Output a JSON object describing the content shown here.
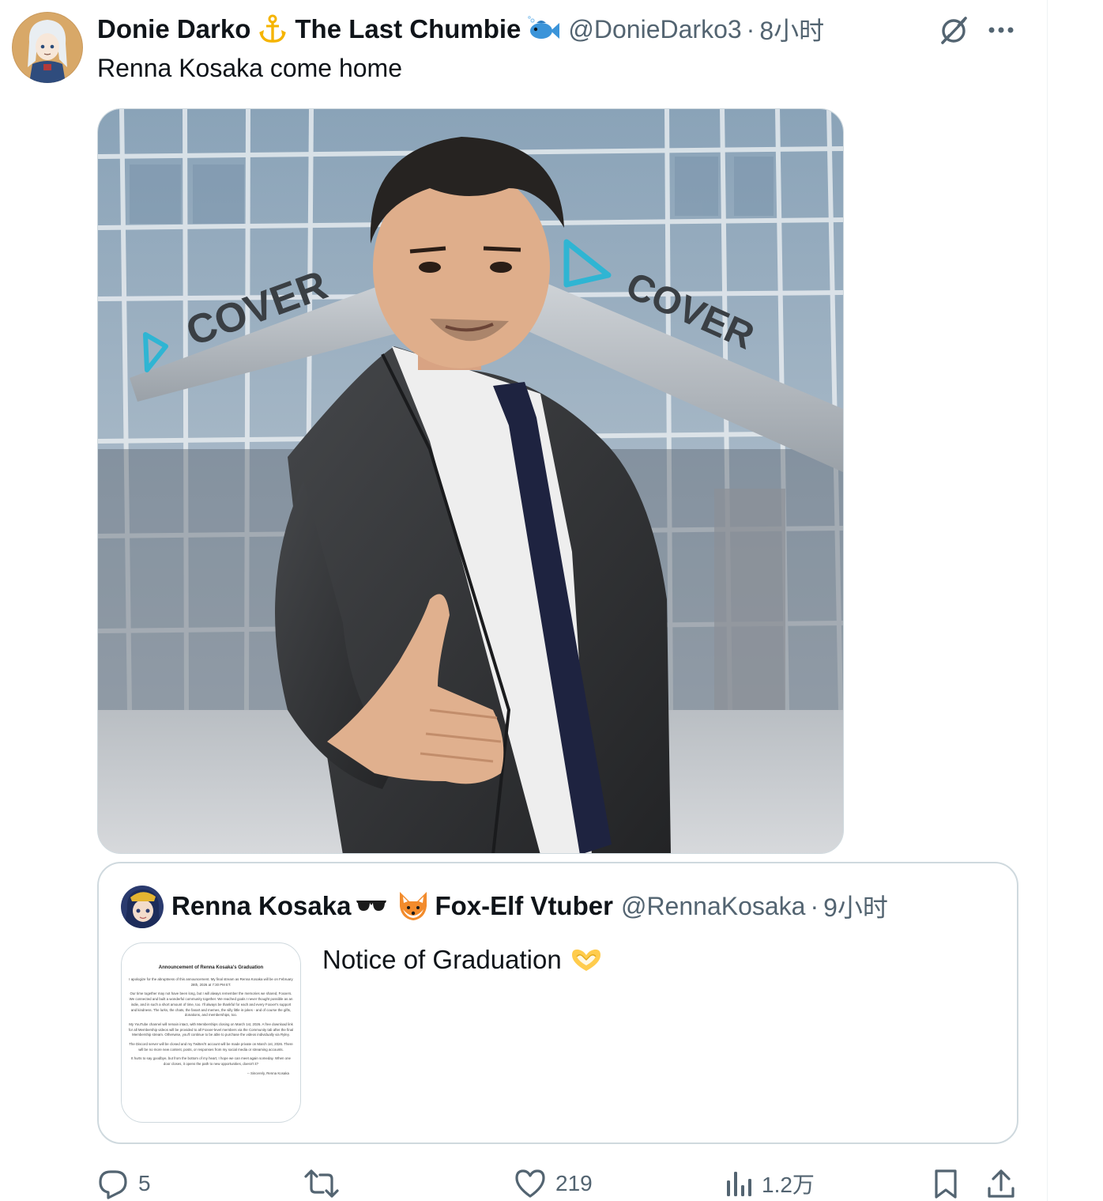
{
  "tweet": {
    "author": {
      "display_name": "Donie Darko",
      "display_name_suffix": "The Last Chumbie",
      "handle": "@DonieDarko3",
      "time": "8小时"
    },
    "text": "Renna Kosaka come home",
    "media": {
      "signage_left": "COVER",
      "signage_right": "COVER"
    }
  },
  "quote": {
    "author": {
      "display_name": "Renna Kosaka",
      "display_name_suffix": "Fox-Elf Vtuber",
      "handle": "@RennaKosaka",
      "time": "9小时"
    },
    "text": "Notice of Graduation",
    "document": {
      "title": "Announcement of Renna Kosaka's Graduation",
      "paragraphs": [
        "I apologize for the abruptness of this announcement. My final stream as Renna Kosaka will be on February 28th, 2026 at 7:30 PM ET.",
        "Our time together may not have been long, but I will always remember the memories we shared, Foxxers. We connected and built a wonderful community together. We reached goals I never thought possible as an indie, and in such a short amount of time, too. I'll always be thankful for each and every Foxxer's support and kindness. The lurks, the chats, the fanart and memes, the silly little in-jokes - and of course the gifts, donations, and memberships, too.",
        "My YouTube channel will remain intact, with Memberships closing on March 1st, 2026. A free download link for all Membership videos will be provided to all Foxxer-level members via the Community tab after the final Membership stream. Otherwise, you'll continue to be able to purchase the videos individually via Ryley.",
        "The Discord server will be closed and my Twitter/X account will be made private on March 1st, 2026. There will be no more new content, posts, or responses from my social media or streaming accounts.",
        "It hurts to say goodbye, but from the bottom of my heart, I hope we can meet again someday. When one door closes, it opens the path to new opportunities, doesn't it?"
      ],
      "signature": "-- Sincerely, Renna Kosaka"
    }
  },
  "actions": {
    "replies": "5",
    "reposts": "",
    "likes": "219",
    "views": "1.2万"
  },
  "colors": {
    "text_primary": "#0f1419",
    "text_secondary": "#536471",
    "border": "#cfd9de"
  },
  "icons": {
    "grok": "grok-icon",
    "more": "more-icon",
    "reply": "reply-icon",
    "repost": "repost-icon",
    "like": "like-icon",
    "views": "views-icon",
    "bookmark": "bookmark-icon",
    "share": "share-icon"
  }
}
